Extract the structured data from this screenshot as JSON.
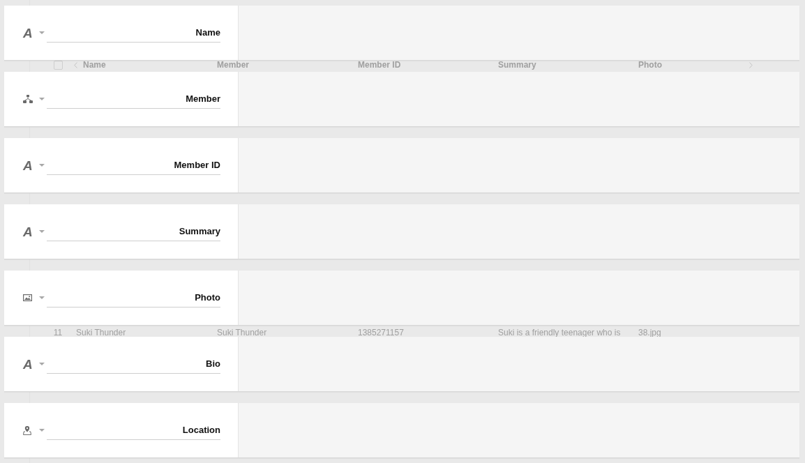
{
  "table": {
    "select_all": {
      "checked": false
    },
    "columns": [
      "Name",
      "Member",
      "Member ID",
      "Summary",
      "Photo"
    ],
    "rows": [
      {
        "number": "11",
        "cells": [
          "Suki Thunder",
          "Suki Thunder",
          "1385271157",
          "Suki is a friendly teenager who is",
          "38.jpg"
        ]
      }
    ]
  },
  "fields": [
    {
      "kind": "text",
      "glyph": "A",
      "name": "Name"
    },
    {
      "kind": "relation",
      "name": "Member"
    },
    {
      "kind": "text",
      "glyph": "A",
      "name": "Member ID"
    },
    {
      "kind": "text",
      "glyph": "A",
      "name": "Summary"
    },
    {
      "kind": "image",
      "name": "Photo"
    },
    {
      "kind": "text",
      "glyph": "A",
      "name": "Bio"
    },
    {
      "kind": "location",
      "name": "Location"
    }
  ]
}
